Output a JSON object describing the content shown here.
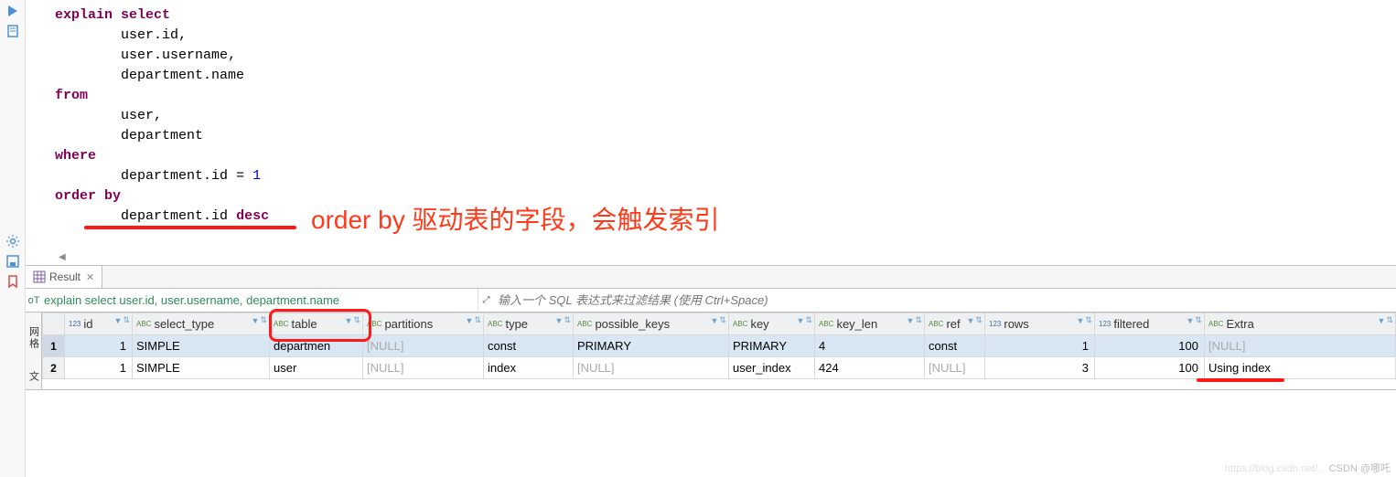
{
  "sql": {
    "lines": [
      {
        "indent": 0,
        "tokens": [
          {
            "t": "explain",
            "c": "kw"
          },
          {
            "t": " ",
            "c": "plain"
          },
          {
            "t": "select",
            "c": "kw"
          }
        ]
      },
      {
        "indent": 2,
        "tokens": [
          {
            "t": "user",
            "c": "plain"
          },
          {
            "t": ".",
            "c": "punct"
          },
          {
            "t": "id",
            "c": "plain"
          },
          {
            "t": ",",
            "c": "punct"
          }
        ]
      },
      {
        "indent": 2,
        "tokens": [
          {
            "t": "user",
            "c": "plain"
          },
          {
            "t": ".",
            "c": "punct"
          },
          {
            "t": "username",
            "c": "plain"
          },
          {
            "t": ",",
            "c": "punct"
          }
        ]
      },
      {
        "indent": 2,
        "tokens": [
          {
            "t": "department",
            "c": "plain"
          },
          {
            "t": ".",
            "c": "punct"
          },
          {
            "t": "name",
            "c": "plain"
          }
        ]
      },
      {
        "indent": 0,
        "tokens": [
          {
            "t": "from",
            "c": "kw"
          }
        ]
      },
      {
        "indent": 2,
        "tokens": [
          {
            "t": "user",
            "c": "plain"
          },
          {
            "t": ",",
            "c": "punct"
          }
        ]
      },
      {
        "indent": 2,
        "tokens": [
          {
            "t": "department",
            "c": "plain"
          }
        ]
      },
      {
        "indent": 0,
        "tokens": [
          {
            "t": "where",
            "c": "kw"
          }
        ]
      },
      {
        "indent": 2,
        "tokens": [
          {
            "t": "department",
            "c": "plain"
          },
          {
            "t": ".",
            "c": "punct"
          },
          {
            "t": "id",
            "c": "plain"
          },
          {
            "t": " = ",
            "c": "plain"
          },
          {
            "t": "1",
            "c": "num"
          }
        ]
      },
      {
        "indent": 0,
        "tokens": [
          {
            "t": "order",
            "c": "kw"
          },
          {
            "t": " ",
            "c": "plain"
          },
          {
            "t": "by",
            "c": "kw"
          }
        ]
      },
      {
        "indent": 2,
        "tokens": [
          {
            "t": "department",
            "c": "plain"
          },
          {
            "t": ".",
            "c": "punct"
          },
          {
            "t": "id",
            "c": "plain"
          },
          {
            "t": " ",
            "c": "plain"
          },
          {
            "t": "desc",
            "c": "kw"
          }
        ]
      }
    ]
  },
  "annotation": "order by 驱动表的字段，会触发索引",
  "result_tab_label": "Result",
  "filter": {
    "sql_summary": "explain select user.id, user.username, department.name",
    "placeholder": "输入一个 SQL 表达式来过滤结果 (使用 Ctrl+Space)"
  },
  "side_tabs": {
    "top": "网格",
    "bottom": "文"
  },
  "columns": [
    {
      "key": "id",
      "label": "id",
      "icn": "123"
    },
    {
      "key": "select_type",
      "label": "select_type",
      "icn": "ABC"
    },
    {
      "key": "table",
      "label": "table",
      "icn": "ABC"
    },
    {
      "key": "partitions",
      "label": "partitions",
      "icn": "ABC"
    },
    {
      "key": "type",
      "label": "type",
      "icn": "ABC"
    },
    {
      "key": "possible_keys",
      "label": "possible_keys",
      "icn": "ABC"
    },
    {
      "key": "key",
      "label": "key",
      "icn": "ABC"
    },
    {
      "key": "key_len",
      "label": "key_len",
      "icn": "ABC"
    },
    {
      "key": "ref",
      "label": "ref",
      "icn": "ABC"
    },
    {
      "key": "rows",
      "label": "rows",
      "icn": "123"
    },
    {
      "key": "filtered",
      "label": "filtered",
      "icn": "123"
    },
    {
      "key": "Extra",
      "label": "Extra",
      "icn": "ABC"
    }
  ],
  "rows": [
    {
      "n": "1",
      "id": "1",
      "select_type": "SIMPLE",
      "table": "departmen",
      "partitions": "[NULL]",
      "type": "const",
      "possible_keys": "PRIMARY",
      "key": "PRIMARY",
      "key_len": "4",
      "ref": "const",
      "rows": "1",
      "filtered": "100",
      "Extra": "[NULL]",
      "selected": true
    },
    {
      "n": "2",
      "id": "1",
      "select_type": "SIMPLE",
      "table": "user",
      "partitions": "[NULL]",
      "type": "index",
      "possible_keys": "[NULL]",
      "key": "user_index",
      "key_len": "424",
      "ref": "[NULL]",
      "rows": "3",
      "filtered": "100",
      "Extra": "Using index",
      "selected": false
    }
  ],
  "watermark": {
    "faint": "https://blog.csdn.net/...",
    "main": "CSDN @哪吒"
  }
}
